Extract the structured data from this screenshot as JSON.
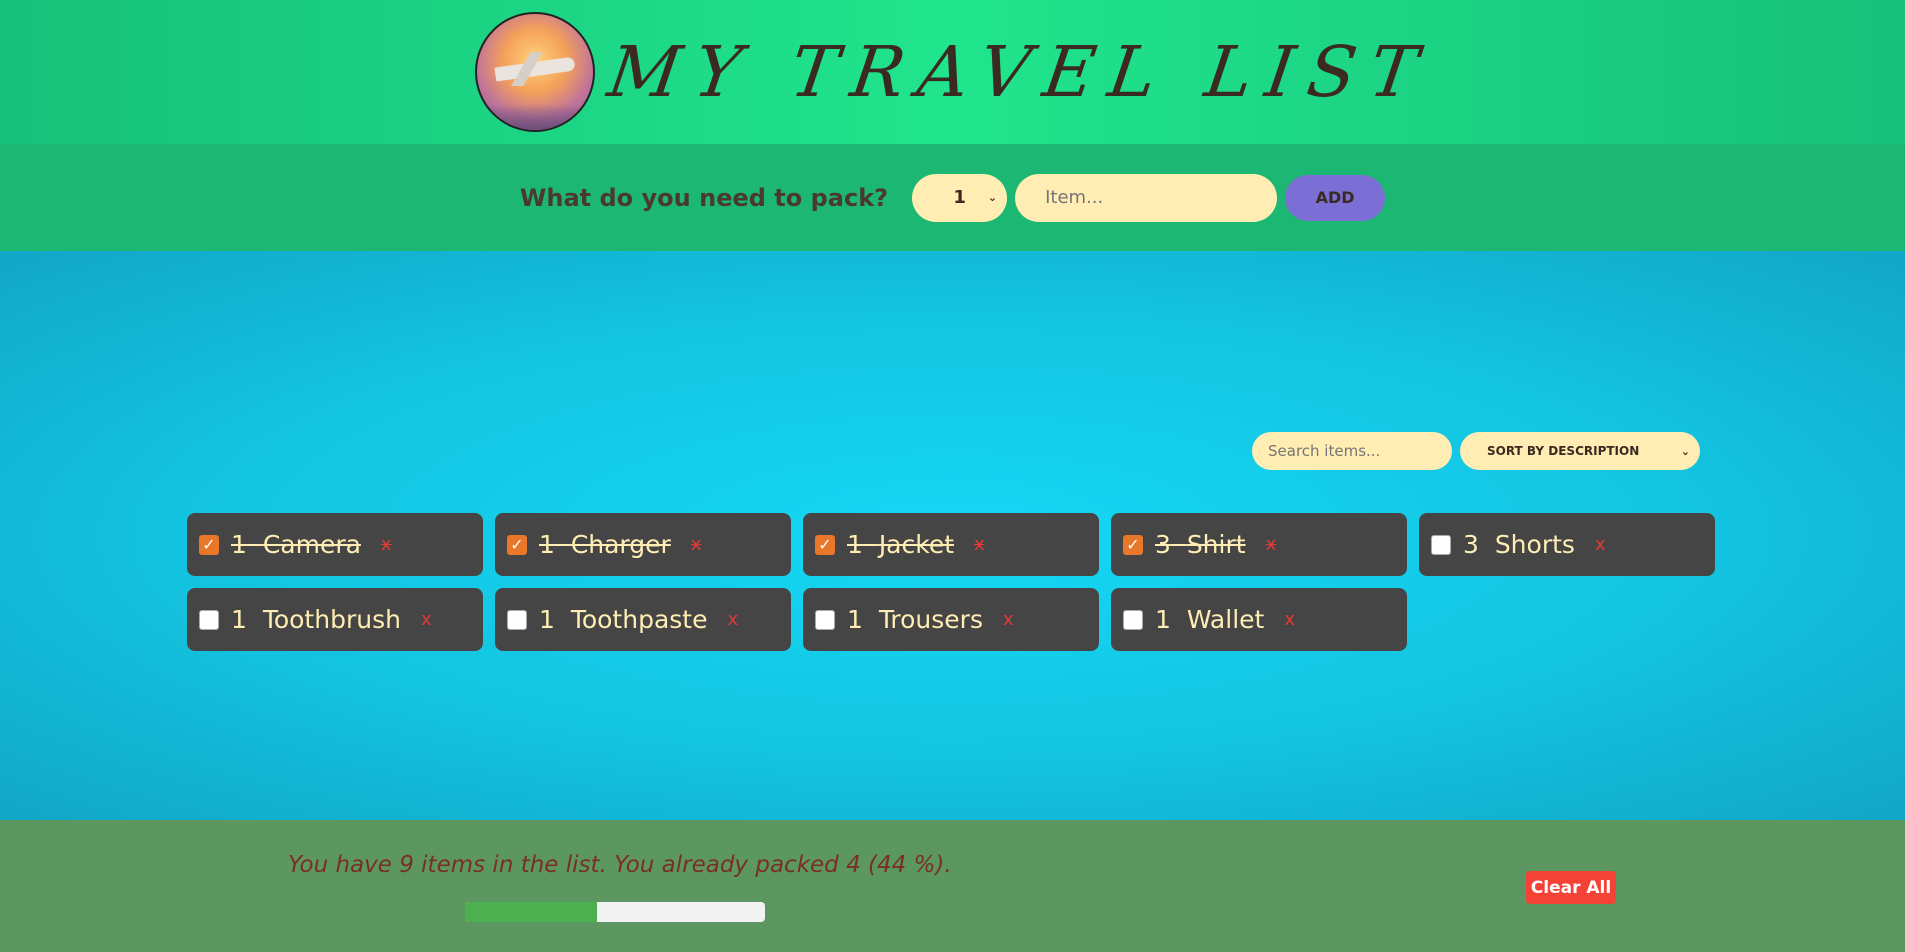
{
  "header": {
    "title": "MY TRAVEL LIST"
  },
  "form": {
    "label": "What do you need to pack?",
    "quantity": "1",
    "item_placeholder": "Item...",
    "add_label": "ADD"
  },
  "controls": {
    "search_placeholder": "Search items...",
    "sort_label": "SORT BY DESCRIPTION"
  },
  "items": [
    {
      "qty": "1",
      "desc": "Camera",
      "packed": true
    },
    {
      "qty": "1",
      "desc": "Charger",
      "packed": true
    },
    {
      "qty": "1",
      "desc": "Jacket",
      "packed": true
    },
    {
      "qty": "3",
      "desc": "Shirt",
      "packed": true
    },
    {
      "qty": "3",
      "desc": "Shorts",
      "packed": false
    },
    {
      "qty": "1",
      "desc": "Toothbrush",
      "packed": false
    },
    {
      "qty": "1",
      "desc": "Toothpaste",
      "packed": false
    },
    {
      "qty": "1",
      "desc": "Trousers",
      "packed": false
    },
    {
      "qty": "1",
      "desc": "Wallet",
      "packed": false
    }
  ],
  "delete_label": "x",
  "footer": {
    "stats": "You have 9 items in the list. You already packed 4 (44 %).",
    "progress_percent": 44,
    "clear_label": "Clear All"
  },
  "colors": {
    "accent_checkbox": "#e8772a",
    "add_button": "#7b6fd6",
    "clear_button": "#f44336",
    "progress": "#4caf50"
  }
}
